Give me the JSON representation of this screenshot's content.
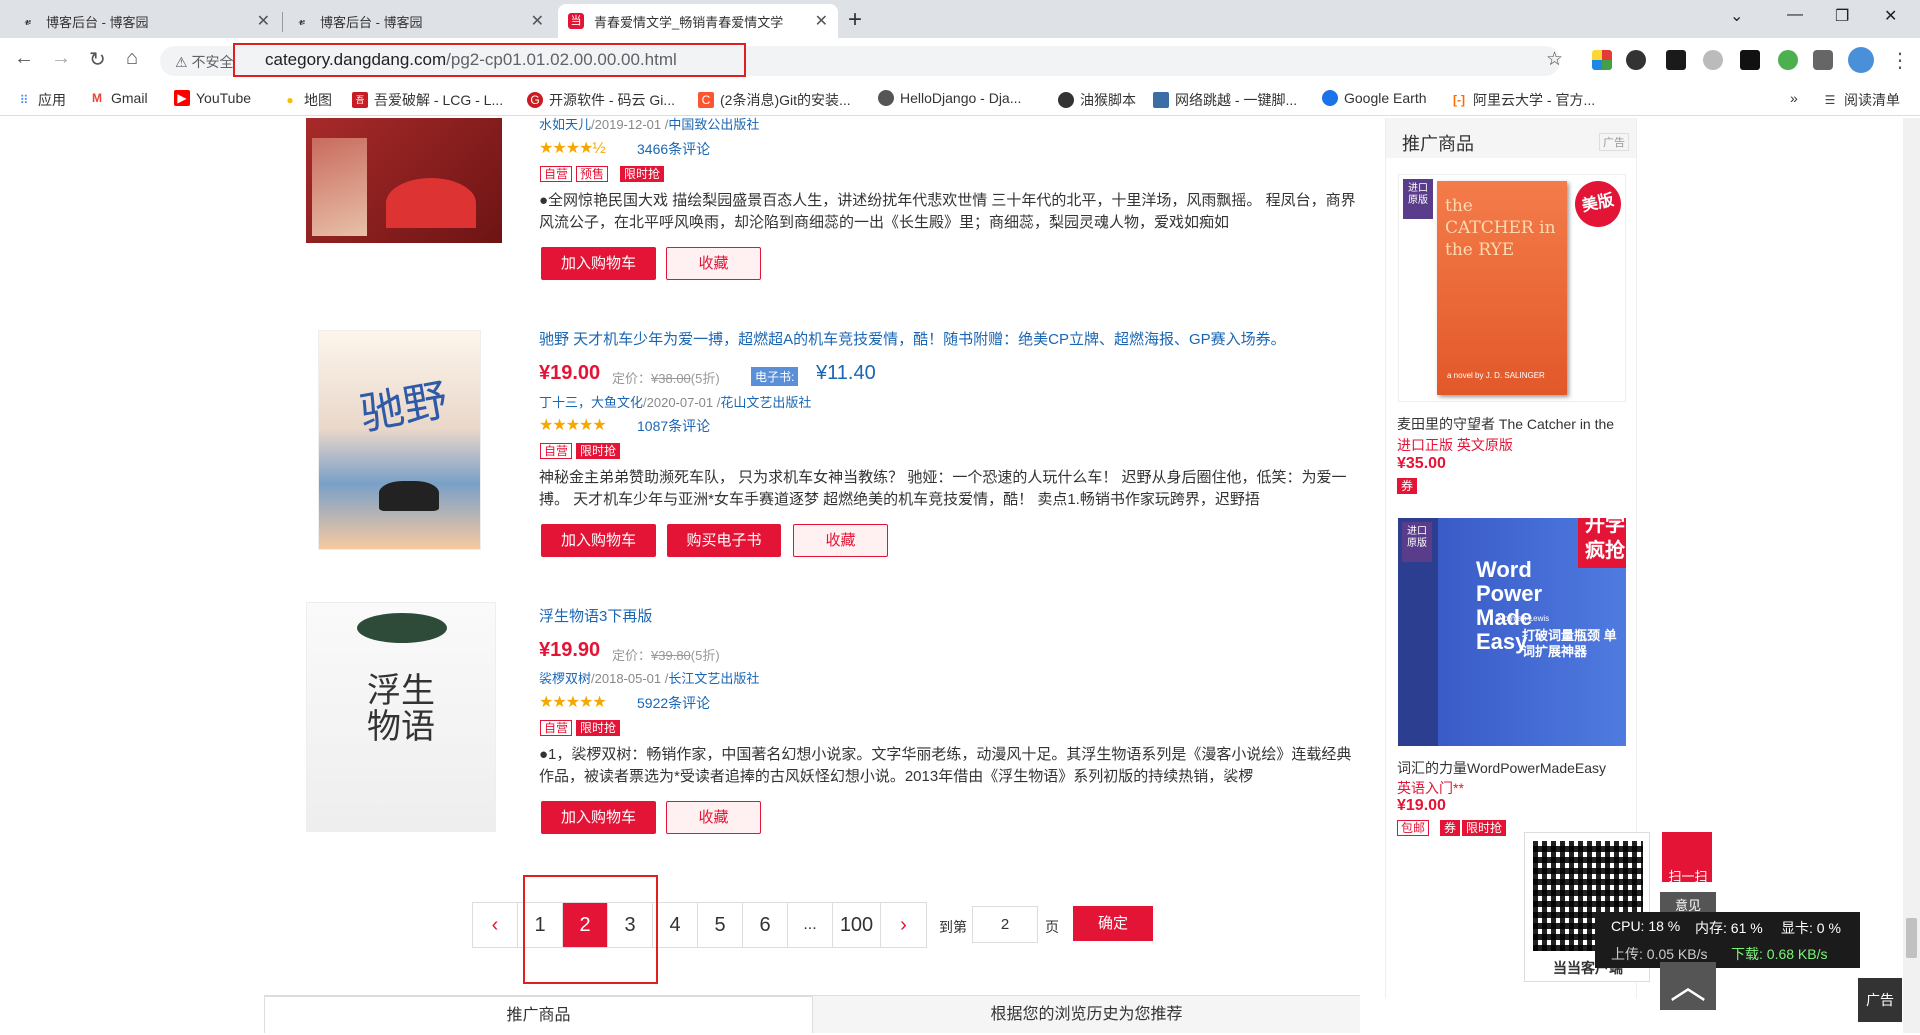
{
  "browser": {
    "tabs": [
      {
        "title": "博客后台 - 博客园",
        "active": false
      },
      {
        "title": "博客后台 - 博客园",
        "active": false
      },
      {
        "title": "青春爱情文学_畅销青春爱情文学",
        "active": true
      }
    ],
    "insecure_label": "不安全",
    "url_host": "category.dangdang.com",
    "url_path": "/pg2-cp01.01.02.00.00.00.html",
    "bookmarks": [
      {
        "label": "应用",
        "icon": "apps-grid-icon",
        "color": "#4285f4"
      },
      {
        "label": "Gmail",
        "icon": "gmail-icon",
        "color": "#ea4335"
      },
      {
        "label": "YouTube",
        "icon": "youtube-icon",
        "color": "#ff0000"
      },
      {
        "label": "地图",
        "icon": "maps-pin-icon",
        "color": "#fbbc04"
      },
      {
        "label": "吾爱破解 - LCG - L...",
        "icon": "52pojie-icon",
        "color": "#c81d25"
      },
      {
        "label": "开源软件 - 码云 Gi...",
        "icon": "gitee-icon",
        "color": "#c71d23"
      },
      {
        "label": "(2条消息)Git的安装...",
        "icon": "csdn-icon",
        "color": "#fc5531"
      },
      {
        "label": "HelloDjango - Dja...",
        "icon": "django-icon",
        "color": "#555"
      },
      {
        "label": "油猴脚本",
        "icon": "tampermonkey-icon",
        "color": "#333"
      },
      {
        "label": "网络跳越 - 一键脚...",
        "icon": "network-icon",
        "color": "#3a6ea5"
      },
      {
        "label": "Google Earth",
        "icon": "google-earth-icon",
        "color": "#1a73e8"
      },
      {
        "label": "阿里云大学 - 官方...",
        "icon": "aliyun-icon",
        "color": "#ff6a00"
      }
    ],
    "overflow_label": "»",
    "reading_list": "阅读清单"
  },
  "products": [
    {
      "title": "",
      "authors": "水如天儿",
      "date": "/2019-12-01 /",
      "publisher": "中国致公出版社",
      "stars": "★★★★½",
      "reviews": "3466条评论",
      "tags": [
        {
          "text": "自营",
          "solid": false
        },
        {
          "text": "预售",
          "solid": false
        },
        {
          "text": "限时抢",
          "solid": true
        }
      ],
      "desc": "●全网惊艳民国大戏 描绘梨园盛景百态人生，讲述纷扰年代悲欢世情 三十年代的北平，十里洋场，风雨飘摇。 程凤台，商界风流公子，在北平呼风唤雨，却沦陷到商细蕊的一出《长生殿》里；商细蕊，梨园灵魂人物，爱戏如痴如",
      "cart": "加入购物车",
      "fav": "收藏"
    },
    {
      "title": "驰野 天才机车少年为爱一搏，超燃超A的机车竞技爱情，酷！随书附赠：绝美CP立牌、超燃海报、GP赛入场券。",
      "price": "¥19.00",
      "list_price_label": "定价：",
      "list_price": "¥38.00",
      "discount": "(5折)",
      "ebook_label": "电子书:",
      "ebook_price": "¥11.40",
      "authors": "丁十三，大鱼文化",
      "date": "/2020-07-01 /",
      "publisher": "花山文艺出版社",
      "stars": "★★★★★",
      "reviews": "1087条评论",
      "tags": [
        {
          "text": "自营",
          "solid": false
        },
        {
          "text": "限时抢",
          "solid": true
        }
      ],
      "desc": "神秘金主弟弟赞助濒死车队， 只为求机车女神当教练？ 驰娅：一个恐速的人玩什么车！ 迟野从身后圈住他，低笑：为爱一搏。 天才机车少年与亚洲*女车手赛道逐梦 超燃绝美的机车竞技爱情，酷！ 卖点1.畅销书作家玩跨界，迟野捂",
      "cart": "加入购物车",
      "buy_ebook": "购买电子书",
      "fav": "收藏"
    },
    {
      "title": "浮生物语3下再版",
      "price": "¥19.90",
      "list_price_label": "定价：",
      "list_price": "¥39.80",
      "discount": "(5折)",
      "authors": "裟椤双树",
      "date": "/2018-05-01 /",
      "publisher": "长江文艺出版社",
      "stars": "★★★★★",
      "reviews": "5922条评论",
      "tags": [
        {
          "text": "自营",
          "solid": false
        },
        {
          "text": "限时抢",
          "solid": true
        }
      ],
      "desc": "●1，裟椤双树：畅销作家，中国著名幻想小说家。文字华丽老练，动漫风十足。其浮生物语系列是《漫客小说绘》连载经典作品，被读者票选为*受读者追捧的古风妖怪幻想小说。2013年借由《浮生物语》系列初版的持续热销，裟椤",
      "cart": "加入购物车",
      "fav": "收藏"
    }
  ],
  "pagination": {
    "prev": "‹",
    "pages": [
      "1",
      "2",
      "3",
      "4",
      "5",
      "6",
      "...",
      "100"
    ],
    "current": "2",
    "next": "›",
    "goto_label": "到第",
    "goto_value": "2",
    "page_unit": "页",
    "confirm": "确定"
  },
  "bottom_tabs": [
    "推广商品",
    "根据您的浏览历史为您推荐"
  ],
  "sidebar": {
    "title": "推广商品",
    "ad_label": "广告",
    "items": [
      {
        "name": "麦田里的守望者 The Catcher in the",
        "sub": "进口正版 英文原版",
        "price": "¥35.00",
        "tags": [
          "券"
        ],
        "cover_title": "the CATCHER in the RYE",
        "cover_author": "a novel by J. D. SALINGER",
        "badge": "美版"
      },
      {
        "name": "词汇的力量WordPowerMadeEasy",
        "sub": "英语入门**",
        "price": "¥19.00",
        "tags": [
          "包邮",
          "券",
          "限时抢"
        ],
        "cover_title": "Word Power Made Easy",
        "cover_author": "Norman Lewis",
        "badge": "开学疯抢",
        "cover_sub": "打破词量瓶颈 单词扩展神器"
      }
    ]
  },
  "floating": {
    "scan": "扫一扫",
    "feedback": "意见",
    "app_label": "当当客户端",
    "ad": "广告"
  },
  "perf": {
    "cpu": "CPU: 18 %",
    "mem": "内存: 61 %",
    "gpu": "显卡: 0 %",
    "up": "上传: 0.05 KB/s",
    "down": "下载: 0.68 KB/s"
  },
  "colors": {
    "accent": "#e31436",
    "link": "#1a66b3"
  }
}
